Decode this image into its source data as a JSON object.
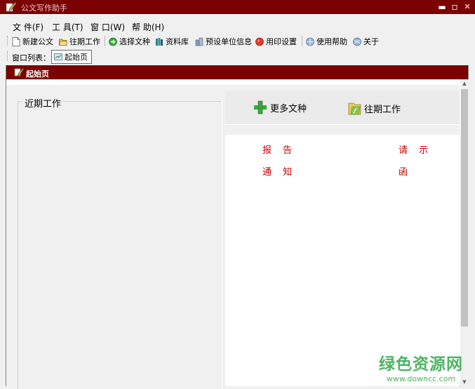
{
  "app": {
    "title": "公文写作助手",
    "window_buttons": {
      "minimize": "▬",
      "maximize": "▫",
      "close": "✕"
    }
  },
  "menu": [
    "文 件(F)",
    "工 具(T)",
    "窗 口(W)",
    "帮 助(H)"
  ],
  "toolbar": {
    "new_doc": "新建公文",
    "past_work": "往期工作",
    "select_type": "选择文种",
    "library": "资料库",
    "preset_org": "预设单位信息",
    "seal_settings": "用印设置",
    "help": "使用帮助",
    "about": "关于"
  },
  "window_list": {
    "label": "窗口列表：",
    "tabs": [
      "起始页"
    ]
  },
  "document": {
    "title": "起始页",
    "recent_group_label": "近期工作",
    "right_buttons": {
      "more_types": "更多文种",
      "past_work": "往期工作"
    },
    "doc_types": [
      "报 告",
      "请 示",
      "通 知",
      "函"
    ]
  },
  "watermark": {
    "main": "绿色资源网",
    "sub": "www.downcc.com"
  },
  "colors": {
    "titlebar": "#7b0000",
    "link_red": "#c00000",
    "watermark_green": "#2ea84a"
  }
}
